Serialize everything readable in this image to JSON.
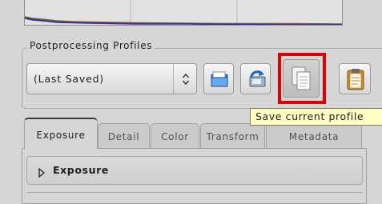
{
  "profiles": {
    "group_title": "Postprocessing Profiles",
    "selected_profile": "(Last Saved)",
    "tooltip": "Save current profile",
    "icons": {
      "combo_arrow": "updown-arrows-icon",
      "load": "folder-open-icon",
      "save": "save-to-disk-icon",
      "copy": "copy-icon",
      "paste": "clipboard-paste-icon"
    }
  },
  "tabs": [
    {
      "label": "Exposure"
    },
    {
      "label": "Detail"
    },
    {
      "label": "Color"
    },
    {
      "label": "Transform"
    },
    {
      "label": "Metadata"
    }
  ],
  "active_tab": "Exposure",
  "panel": {
    "section_label": "Exposure",
    "section_icon": "expand-triangle-icon"
  },
  "colors": {
    "highlight": "#e10000",
    "tooltip_bg": "#ffffc4"
  }
}
